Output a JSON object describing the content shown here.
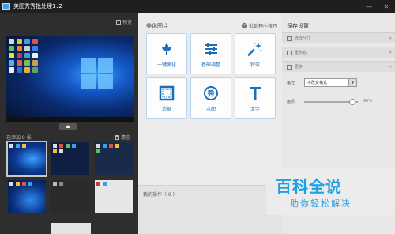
{
  "window": {
    "title": "美图秀秀批处理1.2",
    "minimize_glyph": "—",
    "close_glyph": "✕"
  },
  "left_panel": {
    "preview_label": "预览",
    "added_label": "已添加 9 张",
    "clear_label": "清空"
  },
  "center_panel": {
    "section_title": "美化图片",
    "tips_label": "批处理小技巧",
    "help_glyph": "?",
    "tools": [
      {
        "label": "一键美化",
        "icon": "flower-icon"
      },
      {
        "label": "基础调整",
        "icon": "sliders-icon"
      },
      {
        "label": "特效",
        "icon": "magic-wand-icon"
      },
      {
        "label": "边框",
        "icon": "frame-icon"
      },
      {
        "label": "水印",
        "icon": "watermark-icon"
      },
      {
        "label": "文字",
        "icon": "text-icon"
      }
    ],
    "operations_label": "我的操作（ 0 ）"
  },
  "right_panel": {
    "title": "保存设置",
    "rows": [
      {
        "label": "修改尺寸"
      },
      {
        "label": "重命名"
      },
      {
        "label": "更多"
      }
    ],
    "format_label": "格式",
    "format_value": "不改变格式",
    "quality_label": "画质",
    "quality_value": "90%",
    "quality_fraction": 0.9
  },
  "watermark": {
    "main": "百科全说",
    "sub": "助你轻松解决"
  },
  "colors": {
    "accent": "#1b6fb7",
    "watermark": "#1ea0e6"
  }
}
